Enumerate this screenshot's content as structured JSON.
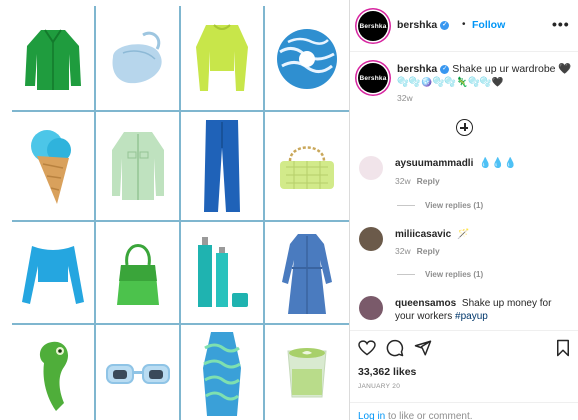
{
  "post_header": {
    "username": "bershka",
    "separator": "•",
    "follow_label": "Follow",
    "more_label": "•••",
    "avatar_text": "Bershka"
  },
  "caption": {
    "username": "bershka",
    "text": "Shake up ur wardrobe 🖤",
    "emoji_line": "🫧🫧🪩🫧🫧🦎🫧🫧🖤",
    "age": "32w"
  },
  "load_more_icon": "plus-circle-icon",
  "comments": [
    {
      "username": "aysuumammadli",
      "text": "💧💧💧",
      "age": "32w",
      "reply_label": "Reply",
      "view_replies": "View replies (1)",
      "avatar_color": "#f1e4ea"
    },
    {
      "username": "miliicasavic",
      "text": "🪄",
      "age": "32w",
      "reply_label": "Reply",
      "view_replies": "View replies (1)",
      "avatar_color": "#6b5a4a"
    },
    {
      "username": "queensamos",
      "text": "Shake up money for your workers",
      "hashtag": "#payup",
      "avatar_color": "#7a5a6a"
    }
  ],
  "actions": {
    "like_icon": "heart-icon",
    "comment_icon": "comment-icon",
    "share_icon": "send-icon",
    "save_icon": "bookmark-icon",
    "likes": "33,362 likes",
    "date": "JANUARY 20"
  },
  "login_prompt": {
    "link": "Log in",
    "rest": " to like or comment."
  },
  "grid_items": [
    "green-jacket",
    "blue-bag",
    "lime-crop-top",
    "blue-swirl-donut",
    "ice-cream-cone",
    "mint-jacket",
    "blue-jeans",
    "lime-bag",
    "blue-long-sleeve-top",
    "green-shoulder-bag",
    "teal-perfume-bottles",
    "blue-denim-dress",
    "green-chameleon",
    "blue-sunglasses",
    "wavy-print-dress",
    "matcha-latte"
  ],
  "colors": {
    "accent": "#0095f6",
    "grid_line": "#7fb6cf",
    "text": "#262626",
    "muted": "#8e8e8e"
  }
}
